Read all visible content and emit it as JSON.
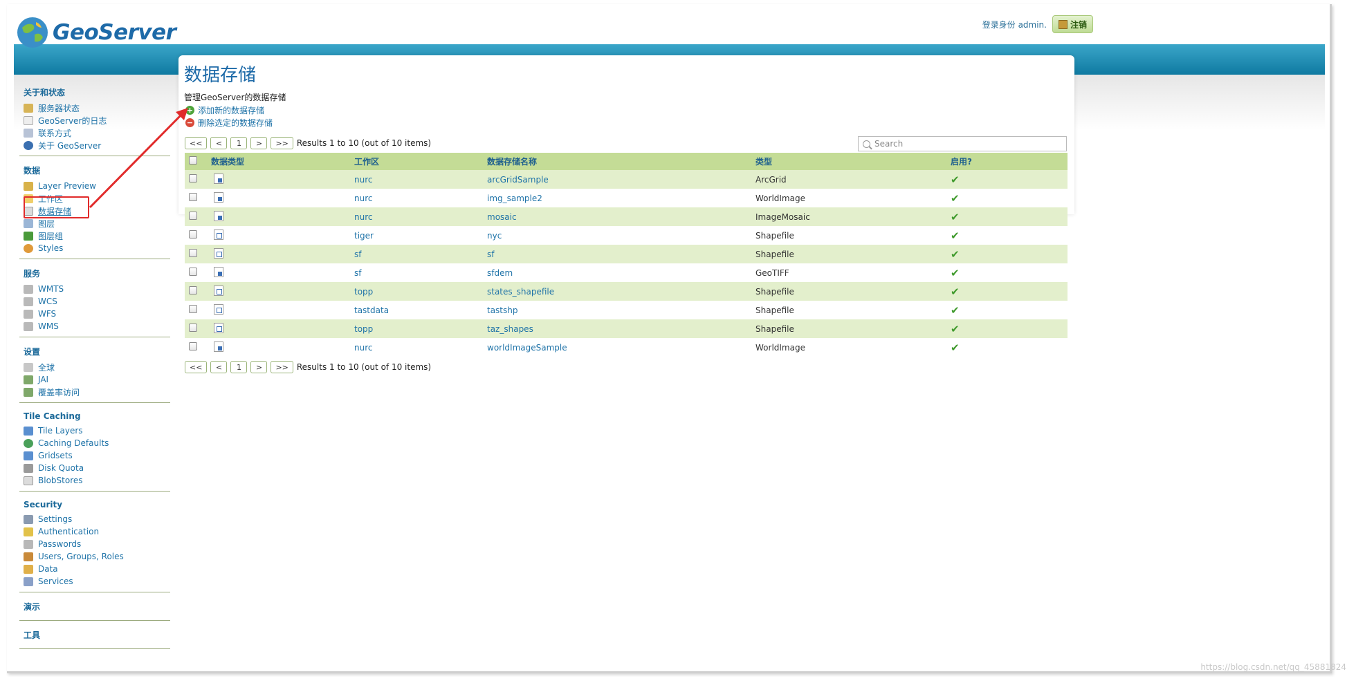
{
  "header": {
    "logo_text": "GeoServer",
    "login_text": "登录身份 admin.",
    "logout_label": "注销"
  },
  "sidebar": {
    "groups": [
      {
        "title": "关于和状态",
        "items": [
          "服务器状态",
          "GeoServer的日志",
          "联系方式",
          "关于 GeoServer"
        ]
      },
      {
        "title": "数据",
        "items": [
          "Layer Preview",
          "工作区",
          "数据存储",
          "图层",
          "图层组",
          "Styles"
        ]
      },
      {
        "title": "服务",
        "items": [
          "WMTS",
          "WCS",
          "WFS",
          "WMS"
        ]
      },
      {
        "title": "设置",
        "items": [
          "全球",
          "JAI",
          "覆盖率访问"
        ]
      },
      {
        "title": "Tile Caching",
        "items": [
          "Tile Layers",
          "Caching Defaults",
          "Gridsets",
          "Disk Quota",
          "BlobStores"
        ]
      },
      {
        "title": "Security",
        "items": [
          "Settings",
          "Authentication",
          "Passwords",
          "Users, Groups, Roles",
          "Data",
          "Services"
        ]
      },
      {
        "title": "演示",
        "items": []
      },
      {
        "title": "工具",
        "items": []
      }
    ]
  },
  "main": {
    "title": "数据存储",
    "description": "管理GeoServer的数据存储",
    "add_label": "添加新的数据存储",
    "remove_label": "删除选定的数据存储",
    "search_placeholder": "Search",
    "pager": {
      "first": "<<",
      "prev": "<",
      "page": "1",
      "next": ">",
      "last": ">>",
      "results": "Results 1 to 10 (out of 10 items)"
    },
    "columns": [
      "数据类型",
      "工作区",
      "数据存储名称",
      "类型",
      "启用?"
    ],
    "rows": [
      {
        "icon": "raster",
        "workspace": "nurc",
        "name": "arcGridSample",
        "type": "ArcGrid",
        "enabled": "✔"
      },
      {
        "icon": "raster",
        "workspace": "nurc",
        "name": "img_sample2",
        "type": "WorldImage",
        "enabled": "✔"
      },
      {
        "icon": "raster",
        "workspace": "nurc",
        "name": "mosaic",
        "type": "ImageMosaic",
        "enabled": "✔"
      },
      {
        "icon": "vector",
        "workspace": "tiger",
        "name": "nyc",
        "type": "Shapefile",
        "enabled": "✔"
      },
      {
        "icon": "vector",
        "workspace": "sf",
        "name": "sf",
        "type": "Shapefile",
        "enabled": "✔"
      },
      {
        "icon": "raster",
        "workspace": "sf",
        "name": "sfdem",
        "type": "GeoTIFF",
        "enabled": "✔"
      },
      {
        "icon": "vector",
        "workspace": "topp",
        "name": "states_shapefile",
        "type": "Shapefile",
        "enabled": "✔"
      },
      {
        "icon": "vector",
        "workspace": "tastdata",
        "name": "tastshp",
        "type": "Shapefile",
        "enabled": "✔"
      },
      {
        "icon": "vector",
        "workspace": "topp",
        "name": "taz_shapes",
        "type": "Shapefile",
        "enabled": "✔"
      },
      {
        "icon": "raster",
        "workspace": "nurc",
        "name": "worldImageSample",
        "type": "WorldImage",
        "enabled": "✔"
      }
    ]
  },
  "colors": {
    "brand_blue": "#1d6aa8",
    "header_band": "#0f7aa1",
    "table_header": "#c4dc96",
    "row_alt": "#e3efcc",
    "highlight": "#e12b2b"
  },
  "watermark": "https://blog.csdn.net/qq_45881824"
}
